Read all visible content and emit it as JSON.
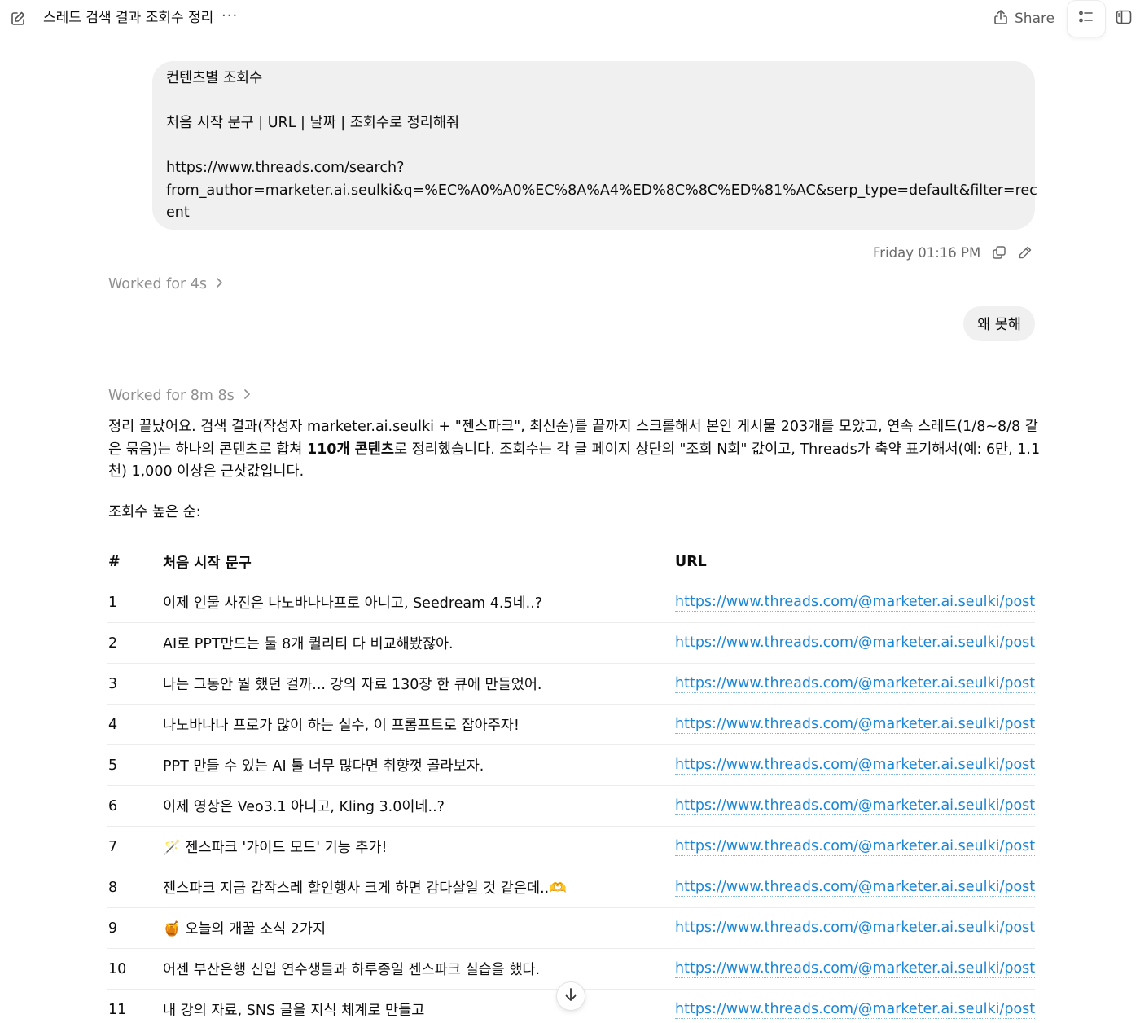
{
  "topbar": {
    "title": "스레드 검색 결과 조회수 정리",
    "more": "···",
    "share_label": "Share"
  },
  "user_message_1": {
    "lines": [
      "컨텐츠별 조회수",
      "",
      "처음 시작 문구 | URL | 날짜 | 조회수로 정리해줘",
      "",
      "https://www.threads.com/search?",
      "from_author=marketer.ai.seulki&q=%EC%A0%A0%EC%8A%A4%ED%8C%8C%ED%81%AC&serp_type=default&filter=rec",
      "ent"
    ],
    "timestamp": "Friday 01:16 PM"
  },
  "worked_1": "Worked for 4s",
  "user_message_2": "왜 못해",
  "worked_2": "Worked for 8m 8s",
  "answer": {
    "p1_a": "정리 끝났어요. 검색 결과(작성자 marketer.ai.seulki + \"젠스파크\", 최신순)를 끝까지 스크롤해서 본인 게시물 203개를 모았고, 연속 스레드(1/8~8/8 같",
    "p1_b_pre": "은 묶음)는 하나의 콘텐츠로 합쳐 ",
    "p1_b_bold": "110개 콘텐츠",
    "p1_b_post": "로 정리했습니다. 조회수는 각 글 페이지 상단의 \"조회 N회\" 값이고, Threads가 축약 표기해서(예: 6만, 1.1",
    "p1_c": "천) 1,000 이상은 근삿값입니다.",
    "sub": "조회수 높은 순:"
  },
  "table": {
    "headers": [
      "#",
      "처음 시작 문구",
      "URL"
    ],
    "rows": [
      {
        "num": "1",
        "text": "이제 인물 사진은 나노바나나프로 아니고, Seedream 4.5네..?",
        "url": "https://www.threads.com/@marketer.ai.seulki/post"
      },
      {
        "num": "2",
        "text": "AI로 PPT만드는 툴 8개 퀄리티 다 비교해봤잖아.",
        "url": "https://www.threads.com/@marketer.ai.seulki/post"
      },
      {
        "num": "3",
        "text": "나는 그동안 뭘 했던 걸까... 강의 자료 130장 한 큐에 만들었어.",
        "url": "https://www.threads.com/@marketer.ai.seulki/post"
      },
      {
        "num": "4",
        "text": "나노바나나 프로가 많이 하는 실수, 이 프롬프트로 잡아주자!",
        "url": "https://www.threads.com/@marketer.ai.seulki/post"
      },
      {
        "num": "5",
        "text": "PPT 만들 수 있는 AI 툴 너무 많다면 취향껏 골라보자.",
        "url": "https://www.threads.com/@marketer.ai.seulki/post"
      },
      {
        "num": "6",
        "text": "이제 영상은 Veo3.1 아니고, Kling 3.0이네..?",
        "url": "https://www.threads.com/@marketer.ai.seulki/post"
      },
      {
        "num": "7",
        "text": "🪄 젠스파크 '가이드 모드' 기능 추가!",
        "url": "https://www.threads.com/@marketer.ai.seulki/post"
      },
      {
        "num": "8",
        "text": "젠스파크 지금 갑작스레 할인행사 크게 하면 감다살일 것 같은데..🫶",
        "url": "https://www.threads.com/@marketer.ai.seulki/post"
      },
      {
        "num": "9",
        "text": "🍯 오늘의 개꿀 소식 2가지",
        "url": "https://www.threads.com/@marketer.ai.seulki/post"
      },
      {
        "num": "10",
        "text": "어젠 부산은행 신입 연수생들과 하루종일 젠스파크 실습을 했다.",
        "url": "https://www.threads.com/@marketer.ai.seulki/post"
      },
      {
        "num": "11",
        "text": "내 강의 자료, SNS 글을 지식 체계로 만들고",
        "url": "https://www.threads.com/@marketer.ai.seulki/post"
      }
    ]
  },
  "icons": [
    "compose-icon",
    "share-icon",
    "list-icon",
    "sidebar-icon",
    "copy-icon",
    "edit-icon",
    "chevron-right-icon",
    "arrow-down-icon"
  ]
}
